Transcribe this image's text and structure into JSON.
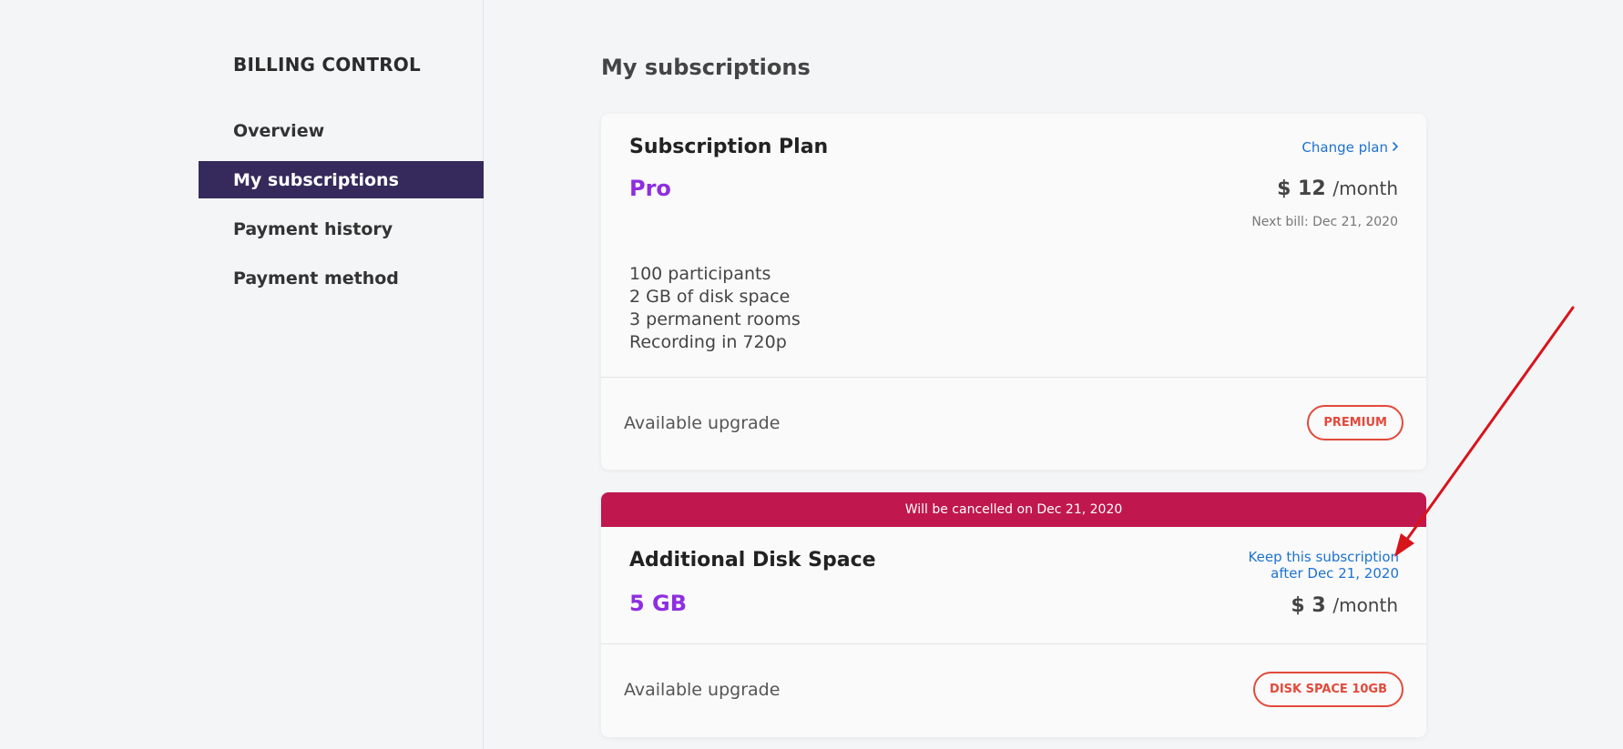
{
  "sidebar": {
    "title": "BILLING CONTROL",
    "items": [
      {
        "label": "Overview"
      },
      {
        "label": "My subscriptions"
      },
      {
        "label": "Payment history"
      },
      {
        "label": "Payment method"
      }
    ]
  },
  "main": {
    "title": "My subscriptions",
    "plan_card": {
      "title": "Subscription Plan",
      "change_link": "Change plan",
      "plan_name": "Pro",
      "price_amount": "$ 12",
      "price_period": "/month",
      "next_bill": "Next bill: Dec 21, 2020",
      "features": [
        "100 participants",
        "2 GB of disk space",
        "3 permanent rooms",
        "Recording in 720p"
      ],
      "upgrade_label": "Available upgrade",
      "upgrade_button": "PREMIUM"
    },
    "disk_card": {
      "banner": "Will be cancelled on Dec 21, 2020",
      "title": "Additional Disk Space",
      "keep_link_line1": "Keep this subscription",
      "keep_link_line2": "after Dec 21, 2020",
      "plan_name": "5 GB",
      "price_amount": "$ 3",
      "price_period": "/month",
      "upgrade_label": "Available upgrade",
      "upgrade_button": "DISK SPACE 10GB"
    }
  },
  "colors": {
    "accent_purple": "#8e2ee0",
    "sidebar_active": "#352a5b",
    "banner_red": "#c0174e",
    "link_blue": "#1d72d0",
    "upgrade_red": "#e24a3b",
    "annotation_arrow": "#d8141b"
  },
  "icons": {
    "chevron": "chevron-right-icon",
    "annotation": "red-arrow-annotation"
  }
}
